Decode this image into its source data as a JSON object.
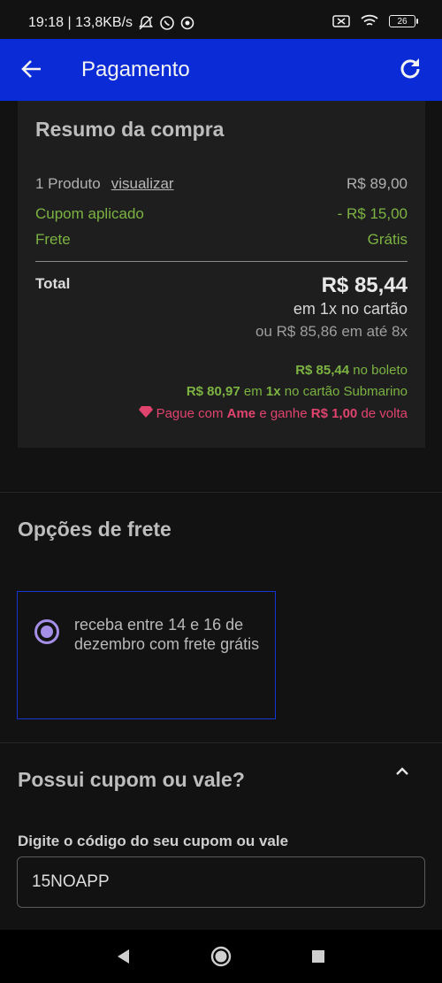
{
  "status_bar": {
    "time_speed": "19:18 | 13,8KB/s",
    "battery": "26"
  },
  "app_bar": {
    "title": "Pagamento"
  },
  "summary": {
    "title": "Resumo da compra",
    "product_count": "1 Produto",
    "view_link": "visualizar",
    "product_price": "R$ 89,00",
    "coupon_label": "Cupom aplicado",
    "coupon_value": "- R$ 15,00",
    "shipping_label": "Frete",
    "shipping_value": "Grátis",
    "total_label": "Total",
    "total_value": "R$ 85,44",
    "installment_1": "em 1x no cartão",
    "installment_2": "ou R$ 85,86 em até 8x",
    "boleto_value": "R$ 85,44",
    "boleto_text": "no boleto",
    "card_value": "R$ 80,97",
    "card_em": "em",
    "card_times": "1x",
    "card_text": "no cartão Submarino",
    "ame_prefix": "Pague com",
    "ame_brand": "Ame",
    "ame_mid": "e ganhe",
    "ame_value": "R$ 1,00",
    "ame_suffix": "de volta"
  },
  "shipping": {
    "title": "Opções de frete",
    "option_text": "receba entre 14 e 16 de dezembro com frete grátis"
  },
  "coupon": {
    "title": "Possui cupom ou vale?",
    "field_label": "Digite o código do seu cupom ou vale",
    "field_value": "15NOAPP"
  },
  "colors": {
    "app_bar": "#0a2bd6",
    "green": "#7cb342",
    "ame_pink": "#e0436e",
    "radio": "#a58ee6"
  }
}
